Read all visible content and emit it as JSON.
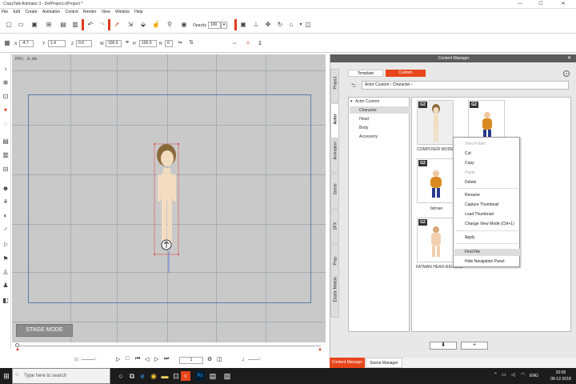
{
  "app": {
    "title": "CrazyTalk Animator 3 - DefProject.ctProject *"
  },
  "window_controls": {
    "minimize": "—",
    "maximize": "☐",
    "close": "✕"
  },
  "menu": [
    "File",
    "Edit",
    "Create",
    "Animation",
    "Control",
    "Render",
    "View",
    "Window",
    "Help"
  ],
  "toolbar": {
    "opacity_label": "Opacity",
    "opacity_value": "100"
  },
  "transform": {
    "x_label": "X",
    "x_value": "-4.7",
    "y_label": "Y",
    "y_value": "1.4",
    "z_label": "Z",
    "z_value": "0.0",
    "w_label": "W",
    "w_value": "100.0",
    "h_label": "H",
    "h_value": "100.0",
    "r_label": "R",
    "r_value": "0"
  },
  "stage": {
    "fps": "FPS: 0.00",
    "mode_button": "STAGE MODE"
  },
  "timeline": {
    "frame": "1"
  },
  "content_manager": {
    "title": "Content Manager",
    "close": "✕",
    "tab_template": "Template",
    "tab_custom": "Custom",
    "breadcrumb": "Actor Custom › Character ›",
    "side_tabs": [
      "Project",
      "Actor",
      "Animation",
      "Scene",
      "SFX",
      "Prop",
      "Elastic Motion"
    ],
    "tree": {
      "root": "Actor Custom",
      "items": [
        "Character",
        "Head",
        "Body",
        "Accessory"
      ]
    },
    "thumbnails": [
      {
        "badge": "G2",
        "label": "COMPOSER MODE"
      },
      {
        "badge": "G2",
        "label": ""
      },
      {
        "badge": "G2",
        "label": "fatman"
      },
      {
        "badge": "G2",
        "label": "FATMAN HEAD-RIGGING"
      }
    ],
    "buttons": {
      "download": "⬇",
      "add": "+"
    },
    "bottom_tabs": [
      "Content Manager",
      "Scene Manager"
    ]
  },
  "context_menu": {
    "items": [
      {
        "label": "View Folder",
        "enabled": false
      },
      {
        "label": "Cut",
        "enabled": true
      },
      {
        "label": "Copy",
        "enabled": true
      },
      {
        "label": "Paste",
        "enabled": false
      },
      {
        "label": "Delete",
        "enabled": true
      },
      {
        "label": "Rename",
        "enabled": true
      },
      {
        "label": "Capture Thumbnail",
        "enabled": true
      },
      {
        "label": "Load Thumbnail",
        "enabled": true
      },
      {
        "label": "Change View Mode (Ctrl+1)",
        "enabled": true
      },
      {
        "label": "Apply",
        "enabled": true
      },
      {
        "label": "Find File",
        "enabled": true
      },
      {
        "label": "Hide Navigation Panel",
        "enabled": true
      }
    ]
  },
  "taskbar": {
    "search_placeholder": "Type here to search",
    "lang": "ENG",
    "time": "20:05",
    "date": "06-12-2018"
  },
  "colors": {
    "accent": "#e8461b",
    "stage_bg": "#c9c9c9",
    "frame": "#5b7fa8"
  }
}
